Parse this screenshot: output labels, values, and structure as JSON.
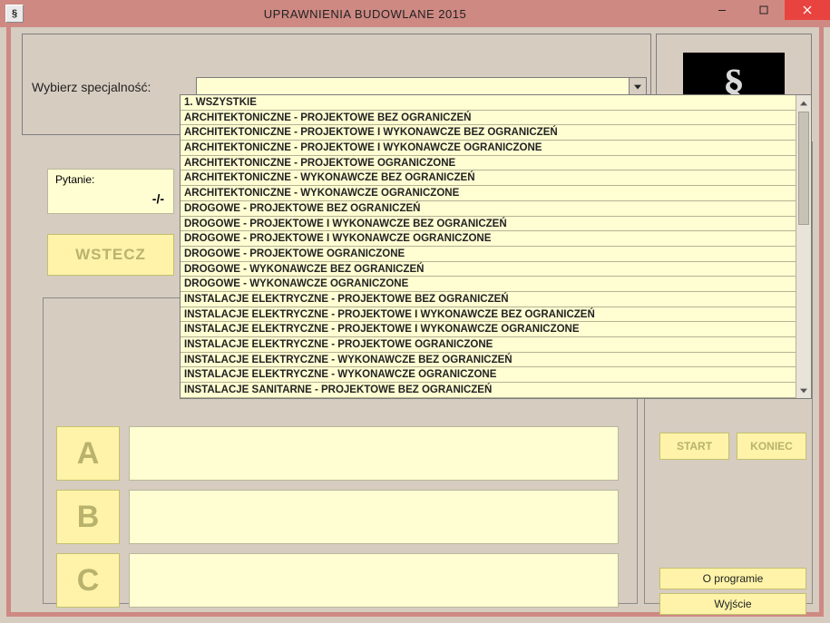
{
  "window": {
    "title": "UPRAWNIENIA BUDOWLANE 2015",
    "app_icon_text": "§"
  },
  "panel_top": {
    "label": "Wybierz specjalność:",
    "combo_value": ""
  },
  "logo": {
    "symbol": "§"
  },
  "question_counter": {
    "label": "Pytanie:",
    "value": "-/-"
  },
  "buttons": {
    "back": "WSTECZ",
    "a": "A",
    "b": "B",
    "c": "C",
    "start": "START",
    "end": "KONIEC",
    "about": "O programie",
    "exit": "Wyjście"
  },
  "dropdown_items": [
    "1. WSZYSTKIE",
    "ARCHITEKTONICZNE - PROJEKTOWE BEZ OGRANICZEŃ",
    "ARCHITEKTONICZNE - PROJEKTOWE I WYKONAWCZE BEZ OGRANICZEŃ",
    "ARCHITEKTONICZNE - PROJEKTOWE I WYKONAWCZE OGRANICZONE",
    "ARCHITEKTONICZNE - PROJEKTOWE OGRANICZONE",
    "ARCHITEKTONICZNE - WYKONAWCZE BEZ OGRANICZEŃ",
    "ARCHITEKTONICZNE - WYKONAWCZE OGRANICZONE",
    "DROGOWE - PROJEKTOWE BEZ OGRANICZEŃ",
    "DROGOWE - PROJEKTOWE I WYKONAWCZE BEZ OGRANICZEŃ",
    "DROGOWE - PROJEKTOWE I WYKONAWCZE OGRANICZONE",
    "DROGOWE - PROJEKTOWE OGRANICZONE",
    "DROGOWE - WYKONAWCZE BEZ OGRANICZEŃ",
    "DROGOWE - WYKONAWCZE OGRANICZONE",
    "INSTALACJE ELEKTRYCZNE - PROJEKTOWE BEZ OGRANICZEŃ",
    "INSTALACJE ELEKTRYCZNE - PROJEKTOWE I WYKONAWCZE BEZ OGRANICZEŃ",
    "INSTALACJE ELEKTRYCZNE - PROJEKTOWE I WYKONAWCZE OGRANICZONE",
    "INSTALACJE ELEKTRYCZNE - PROJEKTOWE OGRANICZONE",
    "INSTALACJE ELEKTRYCZNE - WYKONAWCZE BEZ OGRANICZEŃ",
    "INSTALACJE ELEKTRYCZNE - WYKONAWCZE OGRANICZONE",
    "INSTALACJE SANITARNE - PROJEKTOWE BEZ OGRANICZEŃ"
  ]
}
